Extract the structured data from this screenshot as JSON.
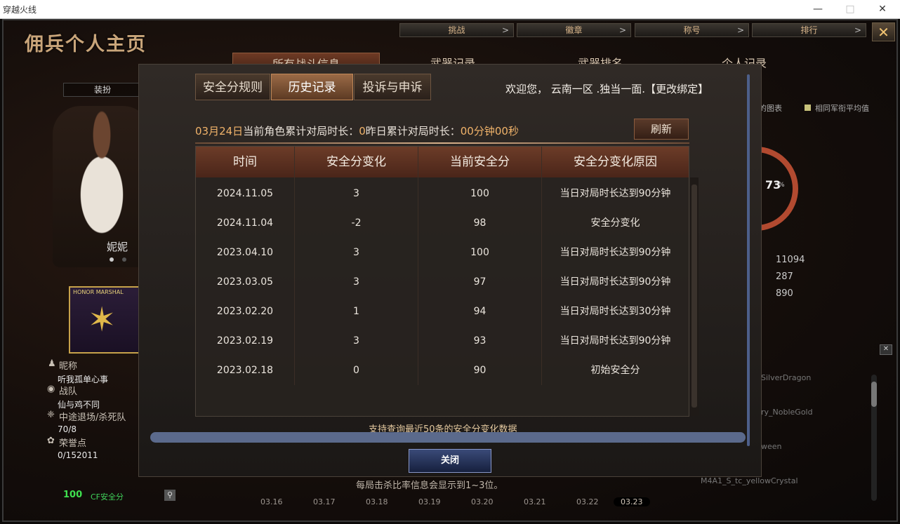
{
  "window": {
    "title": "穿越火线"
  },
  "app": {
    "brand": "佣兵个人主页",
    "top_nav": [
      {
        "label": "挑战"
      },
      {
        "label": "徽章"
      },
      {
        "label": "称号"
      },
      {
        "label": "排行"
      }
    ],
    "close_icon": "close-icon",
    "tabs": [
      {
        "label": "所有战斗信息"
      },
      {
        "label": "武器记录"
      },
      {
        "label": "武器排名"
      },
      {
        "label": "个人记录"
      }
    ],
    "dress_label": "装扮",
    "character_name": "妮妮",
    "medal_text": "HONOR MARSHAL",
    "profile": {
      "nickname_label": "昵称",
      "nickname": "听我孤单心事",
      "team_label": "战队",
      "team": "仙与鸡不同",
      "leave_label": "中途退场/杀死队",
      "leave_value": "70/8",
      "honor_label": "荣誉点",
      "honor_value": "0/152011"
    },
    "cf_score_value": "100",
    "cf_score_label": "CF安全分",
    "right_panel": {
      "chart_legend_1": "的图表",
      "chart_legend_2": "相同军衔平均值",
      "percent": "73",
      "stats": [
        "11094",
        "287",
        "890"
      ],
      "weapons": [
        "SilverDragon",
        "ry_NobleGold",
        "ween",
        "M4A1_S_tc_yellowCrystal"
      ]
    },
    "bottom_tip": "每局击杀比率信息会显示到1~3位。",
    "date_tabs": [
      "03.16",
      "03.17",
      "03.18",
      "03.19",
      "03.20",
      "03.21",
      "03.22",
      "03.23"
    ]
  },
  "modal": {
    "tabs": [
      {
        "label": "安全分规则",
        "active": false
      },
      {
        "label": "历史记录",
        "active": true
      },
      {
        "label": "投诉与申诉",
        "active": false
      }
    ],
    "welcome": "欢迎您， 云南一区 .独当一面.【更改绑定】",
    "notice": {
      "date": "03月24日",
      "part1": "当前角色累计对局时长：",
      "val1": "0",
      "part2": "昨日累计对局时长：",
      "val2": "00分钟00秒"
    },
    "refresh_label": "刷新",
    "columns": [
      "时间",
      "安全分变化",
      "当前安全分",
      "安全分变化原因"
    ],
    "rows": [
      [
        "2024.11.05",
        "3",
        "100",
        "当日对局时长达到90分钟"
      ],
      [
        "2024.11.04",
        "-2",
        "98",
        "安全分变化"
      ],
      [
        "2023.04.10",
        "3",
        "100",
        "当日对局时长达到90分钟"
      ],
      [
        "2023.03.05",
        "3",
        "97",
        "当日对局时长达到90分钟"
      ],
      [
        "2023.02.20",
        "1",
        "94",
        "当日对局时长达到30分钟"
      ],
      [
        "2023.02.19",
        "3",
        "93",
        "当日对局时长达到90分钟"
      ],
      [
        "2023.02.18",
        "0",
        "90",
        "初始安全分"
      ]
    ],
    "footnote": "支持查询最近50条的安全分变化数据",
    "close_label": "关闭"
  }
}
